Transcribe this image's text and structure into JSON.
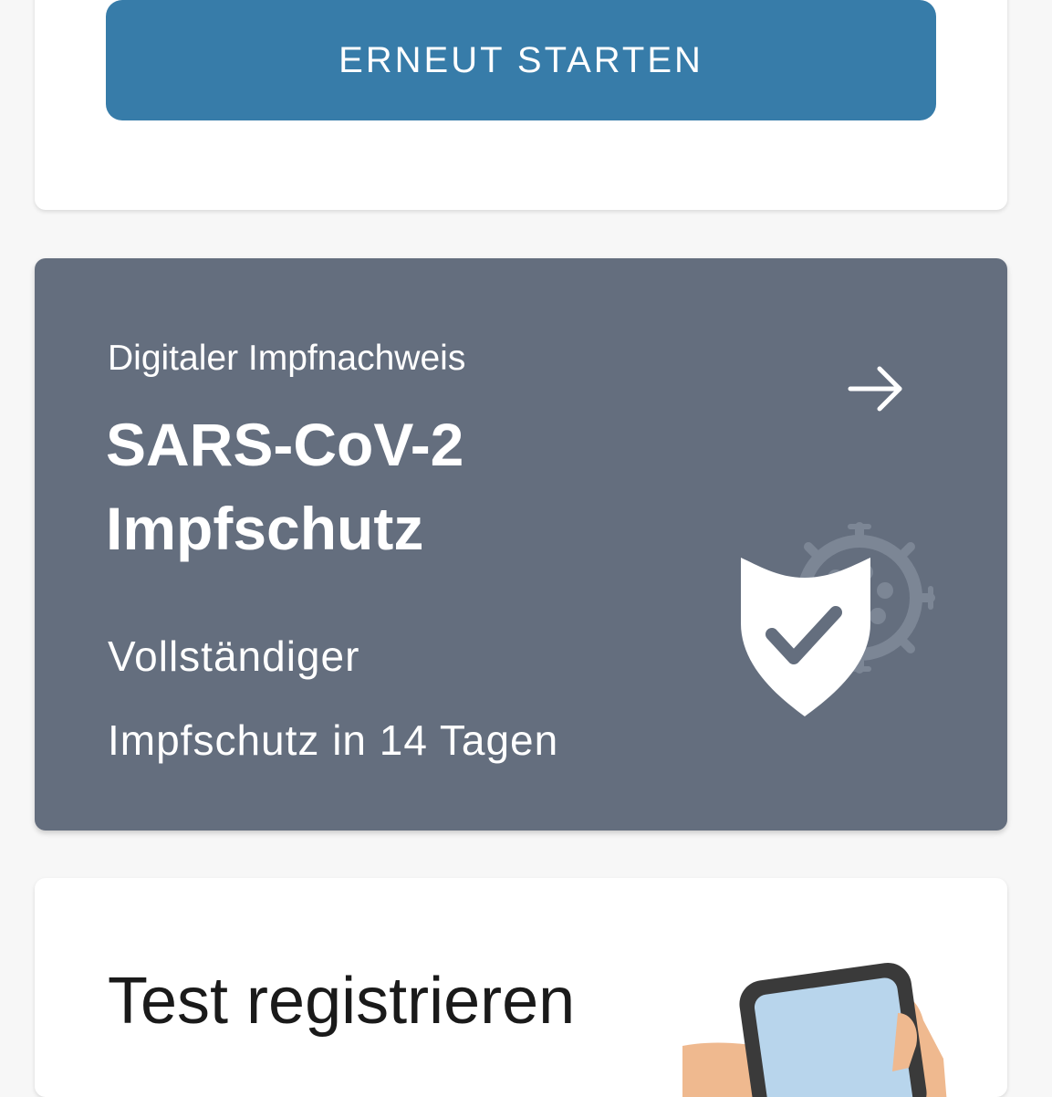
{
  "restart_card": {
    "button_label": "ERNEUT STARTEN"
  },
  "vaccination_card": {
    "kicker": "Digitaler Impfnachweis",
    "title_line1": "SARS-CoV-2",
    "title_line2": "Impfschutz",
    "status_line1": "Vollständiger",
    "status_line2": "Impfschutz in 14 Tagen",
    "icons": [
      "arrow-right-icon",
      "shield-check-icon",
      "virus-icon"
    ]
  },
  "test_card": {
    "title": "Test registrieren",
    "icons": [
      "phone-in-hand-illustration"
    ]
  },
  "colors": {
    "primary_button": "#377ca9",
    "vaccination_card_bg": "#646e7e",
    "background": "#f7f7f7"
  }
}
